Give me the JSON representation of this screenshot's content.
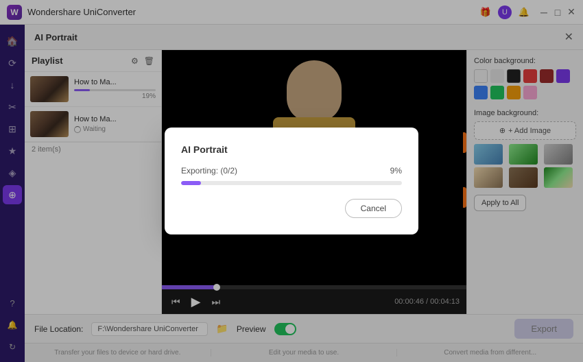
{
  "app": {
    "title": "Wondershare UniConverter",
    "logo_text": "W"
  },
  "title_bar": {
    "icons": {
      "gift": "🎁",
      "profile": "U",
      "bell": "🔔"
    },
    "controls": {
      "minimize": "─",
      "maximize": "□",
      "close": "✕"
    }
  },
  "ai_portrait": {
    "title": "AI Portrait",
    "close": "✕"
  },
  "playlist": {
    "title": "Playlist",
    "items": [
      {
        "name": "How to Ma...",
        "progress_pct": 19,
        "progress_text": "19%",
        "status": null
      },
      {
        "name": "How to Ma...",
        "progress_pct": 0,
        "progress_text": null,
        "status": "Waiting"
      }
    ],
    "item_count": "2 item(s)"
  },
  "video": {
    "time_current": "00:00:46",
    "time_total": "00:04:13",
    "time_display": "00:00:46 / 00:04:13"
  },
  "modal": {
    "title": "AI Portrait",
    "export_label": "Exporting: (0/2)",
    "percent": "9%",
    "progress_pct": 9,
    "cancel_label": "Cancel"
  },
  "right_panel": {
    "color_section_title": "Color background:",
    "colors": [
      {
        "hex": "#f5f5f5",
        "name": "white"
      },
      {
        "hex": "#ffffff",
        "name": "light-gray"
      },
      {
        "hex": "#222222",
        "name": "black",
        "selected": true
      },
      {
        "hex": "#e53e3e",
        "name": "red"
      },
      {
        "hex": "#9b2c2c",
        "name": "dark-red"
      },
      {
        "hex": "#7c3aed",
        "name": "purple"
      },
      {
        "hex": "#3b82f6",
        "name": "blue"
      },
      {
        "hex": "#22c55e",
        "name": "green"
      },
      {
        "hex": "#f59e0b",
        "name": "orange"
      },
      {
        "hex": "#f9a8d4",
        "name": "pink"
      }
    ],
    "image_section_title": "Image background:",
    "add_image_label": "+ Add Image",
    "apply_all_label": "Apply to All"
  },
  "bottom_bar": {
    "file_location_label": "File Location:",
    "file_path": "F:\\Wondershare UniConverter",
    "preview_label": "Preview",
    "export_label": "Export"
  },
  "footer": {
    "text1": "Transfer your files to device or hard drive.",
    "text2": "Edit your media to use.",
    "text3": "Convert media from different..."
  }
}
